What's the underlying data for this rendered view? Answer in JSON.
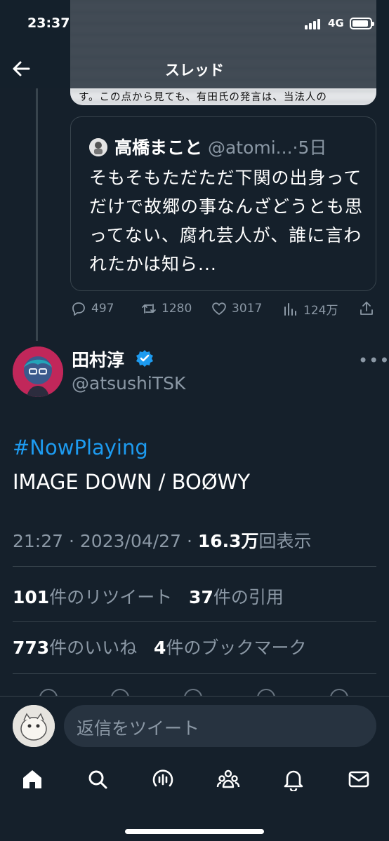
{
  "status_bar": {
    "time": "23:37",
    "network": "4G"
  },
  "header": {
    "title": "スレッド"
  },
  "image_caption": "す。この点から見ても、有田氏の発言は、当法人の",
  "quoted_tweet": {
    "name": "高橋まこと",
    "handle": "@atomi...",
    "separator": "·",
    "age": "5日",
    "text": "そもそもただただ下関の出身ってだけで故郷の事なんざどうとも思ってない、腐れ芸人が、誰に言われたかは知ら..."
  },
  "actions": {
    "replies": "497",
    "retweets": "1280",
    "likes": "3017",
    "views": "124万"
  },
  "tweet": {
    "name": "田村淳",
    "handle": "@atsushiTSK",
    "more": "•••",
    "hashtag": "#NowPlaying",
    "body": "IMAGE DOWN / BOØWY",
    "time": "21:27",
    "dot": "·",
    "date": "2023/04/27",
    "dot2": "·",
    "views_count": "16.3万",
    "views_label": "回表示"
  },
  "stats": {
    "retweets_count": "101",
    "retweets_label": "件のリツイート",
    "quotes_count": "37",
    "quotes_label": "件の引用",
    "likes_count": "773",
    "likes_label": "件のいいね",
    "bookmarks_count": "4",
    "bookmarks_label": "件のブックマーク"
  },
  "composer": {
    "placeholder": "返信をツイート"
  },
  "tabs": [
    "home-icon",
    "search-icon",
    "spaces-icon",
    "communities-icon",
    "notifications-icon",
    "messages-icon"
  ],
  "colors": {
    "background": "#15202b",
    "accent": "#1d9bf0",
    "muted": "#8b98a5",
    "border": "#38444d"
  }
}
